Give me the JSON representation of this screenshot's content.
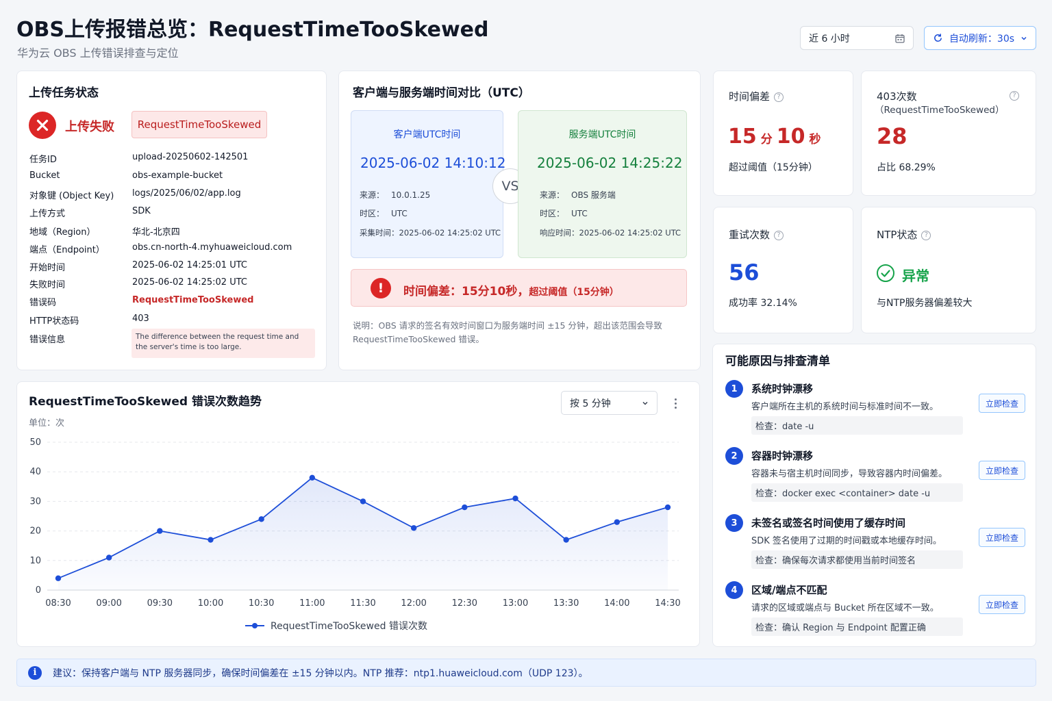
{
  "header": {
    "title": "OBS上传报错总览：RequestTimeTooSkewed",
    "subtitle": "华为云 OBS 上传错误排查与定位",
    "time_range": "近 6 小时",
    "auto_refresh": "自动刷新：30s"
  },
  "upload_status": {
    "title": "上传任务状态",
    "status_label": "上传失败",
    "status_badge": "RequestTimeTooSkewed",
    "fields": [
      {
        "key": "任务ID",
        "value": "upload-20250602-142501"
      },
      {
        "key": "Bucket",
        "value": "obs-example-bucket"
      },
      {
        "key": "对象键 (Object Key)",
        "value": "logs/2025/06/02/app.log"
      },
      {
        "key": "上传方式",
        "value": "SDK"
      },
      {
        "key": "地域（Region）",
        "value": "华北-北京四"
      },
      {
        "key": "端点（Endpoint）",
        "value": "obs.cn-north-4.myhuaweicloud.com"
      },
      {
        "key": "开始时间",
        "value": "2025-06-02 14:25:01 UTC"
      },
      {
        "key": "失败时间",
        "value": "2025-06-02 14:25:02 UTC"
      },
      {
        "key": "错误码",
        "value": "RequestTimeTooSkewed"
      },
      {
        "key": "HTTP状态码",
        "value": "403"
      },
      {
        "key": "错误信息",
        "value": "The difference between the request time and the server's time is too large."
      }
    ]
  },
  "time_compare": {
    "title": "客户端与服务端时间对比（UTC）",
    "vs": "VS",
    "client": {
      "label": "客户端UTC时间",
      "time": "2025-06-02 14:10:12",
      "source_key": "来源：",
      "source": "10.0.1.25",
      "tz_key": "时区：",
      "tz": "UTC",
      "extra_key": "采集时间：",
      "extra": "2025-06-02 14:25:02 UTC"
    },
    "server": {
      "label": "服务端UTC时间",
      "time": "2025-06-02 14:25:22",
      "source_key": "来源：",
      "source": "OBS 服务端",
      "tz_key": "时区：",
      "tz": "UTC",
      "extra_key": "响应时间：",
      "extra": "2025-06-02 14:25:02 UTC"
    },
    "alert_main": "时间偏差：15分10秒，",
    "alert_sub": "超过阈值（15分钟）",
    "note": "说明：OBS 请求的签名有效时间窗口为服务端时间 ±15 分钟，超出该范围会导致 RequestTimeTooSkewed 错误。"
  },
  "stats": {
    "skew": {
      "label": "时间偏差",
      "num1": "15",
      "unit1": "分",
      "num2": "10",
      "unit2": "秒",
      "desc": "超过阈值（15分钟）"
    },
    "count403": {
      "label": "403次数",
      "sublabel": "（RequestTimeTooSkewed）",
      "value": "28",
      "desc": "占比 68.29%"
    },
    "retry": {
      "label": "重试次数",
      "value": "56",
      "desc": "成功率 32.14%"
    },
    "ntp": {
      "label": "NTP状态",
      "value": "异常",
      "desc": "与NTP服务器偏差较大"
    }
  },
  "causes": {
    "title": "可能原因与排查清单",
    "button_label": "立即检查",
    "items": [
      {
        "num": "1",
        "title": "系统时钟漂移",
        "desc": "客户端所在主机的系统时间与标准时间不一致。",
        "cmd": "检查：date -u"
      },
      {
        "num": "2",
        "title": "容器时钟漂移",
        "desc": "容器未与宿主机时间同步，导致容器内时间偏差。",
        "cmd": "检查：docker exec <container> date -u"
      },
      {
        "num": "3",
        "title": "未签名或签名时间使用了缓存时间",
        "desc": "SDK 签名使用了过期的时间戳或本地缓存时间。",
        "cmd": "检查：确保每次请求都使用当前时间签名"
      },
      {
        "num": "4",
        "title": "区域/端点不匹配",
        "desc": "请求的区域或端点与 Bucket 所在区域不一致。",
        "cmd": "检查：确认 Region 与 Endpoint 配置正确"
      }
    ]
  },
  "trend": {
    "title": "RequestTimeTooSkewed 错误次数趋势",
    "unit": "单位：次",
    "interval": "按 5 分钟"
  },
  "chart_data": {
    "type": "area",
    "title": "RequestTimeTooSkewed 错误次数趋势",
    "ylabel": "单位：次",
    "categories": [
      "08:30",
      "09:00",
      "09:30",
      "10:00",
      "10:30",
      "11:00",
      "11:30",
      "12:00",
      "12:30",
      "13:00",
      "13:30",
      "14:00",
      "14:30"
    ],
    "x": [
      0,
      1,
      2,
      3,
      4,
      5,
      6,
      7,
      8,
      9,
      10,
      11,
      12
    ],
    "series": [
      {
        "name": "RequestTimeTooSkewed 错误次数",
        "values": [
          4,
          11,
          20,
          17,
          24,
          38,
          30,
          21,
          28,
          31,
          17,
          23,
          28
        ]
      }
    ],
    "yticks": [
      0,
      10,
      20,
      30,
      40,
      50
    ],
    "ylim": [
      0,
      50
    ],
    "color": "#1d4ed8",
    "grid": true,
    "legend": "bottom-center"
  },
  "footer": {
    "tip": "建议：保持客户端与 NTP 服务器同步，确保时间偏差在 ±15 分钟以内。NTP 推荐：ntp1.huaweicloud.com（UDP 123）。"
  },
  "colors": {
    "primary": "#1d4ed8",
    "danger": "#d32f2f",
    "success": "#16a34a"
  }
}
